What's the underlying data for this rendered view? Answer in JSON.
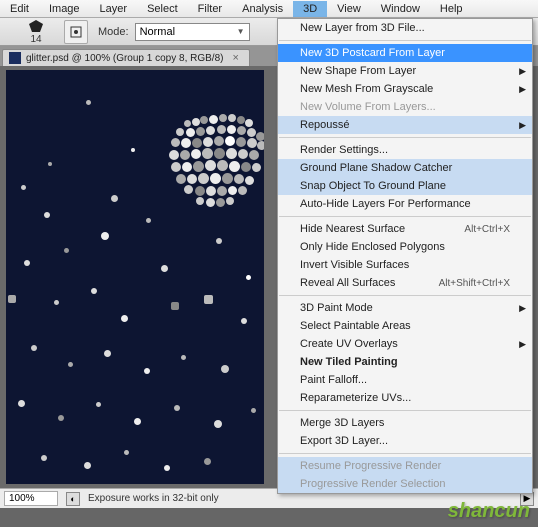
{
  "menubar": {
    "items": [
      "Edit",
      "Image",
      "Layer",
      "Select",
      "Filter",
      "Analysis",
      "3D",
      "View",
      "Window",
      "Help"
    ],
    "active_index": 6
  },
  "toolbar": {
    "tool_number": "14",
    "mode_label": "Mode:",
    "mode_value": "Normal"
  },
  "tab": {
    "title": "glitter.psd @ 100% (Group 1 copy 8, RGB/8)"
  },
  "statusbar": {
    "zoom": "100%",
    "text": "Exposure works in 32-bit only"
  },
  "menu": {
    "items": [
      {
        "label": "New Layer from 3D File...",
        "type": "item"
      },
      {
        "type": "sep"
      },
      {
        "label": "New 3D Postcard From Layer",
        "type": "highlighted"
      },
      {
        "label": "New Shape From Layer",
        "type": "submenu"
      },
      {
        "label": "New Mesh From Grayscale",
        "type": "submenu"
      },
      {
        "label": "New Volume From Layers...",
        "type": "disabled"
      },
      {
        "label": "Repoussé",
        "type": "submenu-soft"
      },
      {
        "type": "sep"
      },
      {
        "label": "Render Settings...",
        "type": "item"
      },
      {
        "label": "Ground Plane Shadow Catcher",
        "type": "soft"
      },
      {
        "label": "Snap Object To Ground Plane",
        "type": "soft"
      },
      {
        "label": "Auto-Hide Layers For Performance",
        "type": "item"
      },
      {
        "type": "sep"
      },
      {
        "label": "Hide Nearest Surface",
        "type": "item",
        "shortcut": "Alt+Ctrl+X"
      },
      {
        "label": "Only Hide Enclosed Polygons",
        "type": "item"
      },
      {
        "label": "Invert Visible Surfaces",
        "type": "item"
      },
      {
        "label": "Reveal All Surfaces",
        "type": "item",
        "shortcut": "Alt+Shift+Ctrl+X"
      },
      {
        "type": "sep"
      },
      {
        "label": "3D Paint Mode",
        "type": "submenu"
      },
      {
        "label": "Select Paintable Areas",
        "type": "item"
      },
      {
        "label": "Create UV Overlays",
        "type": "submenu"
      },
      {
        "label": "New Tiled Painting",
        "type": "bold"
      },
      {
        "label": "Paint Falloff...",
        "type": "item"
      },
      {
        "label": "Reparameterize UVs...",
        "type": "item"
      },
      {
        "type": "sep"
      },
      {
        "label": "Merge 3D Layers",
        "type": "item"
      },
      {
        "label": "Export 3D Layer...",
        "type": "item"
      },
      {
        "type": "sep"
      },
      {
        "label": "Resume Progressive Render",
        "type": "disabled-soft"
      },
      {
        "label": "Progressive Render Selection",
        "type": "disabled-soft"
      }
    ]
  },
  "watermark": "shancun"
}
